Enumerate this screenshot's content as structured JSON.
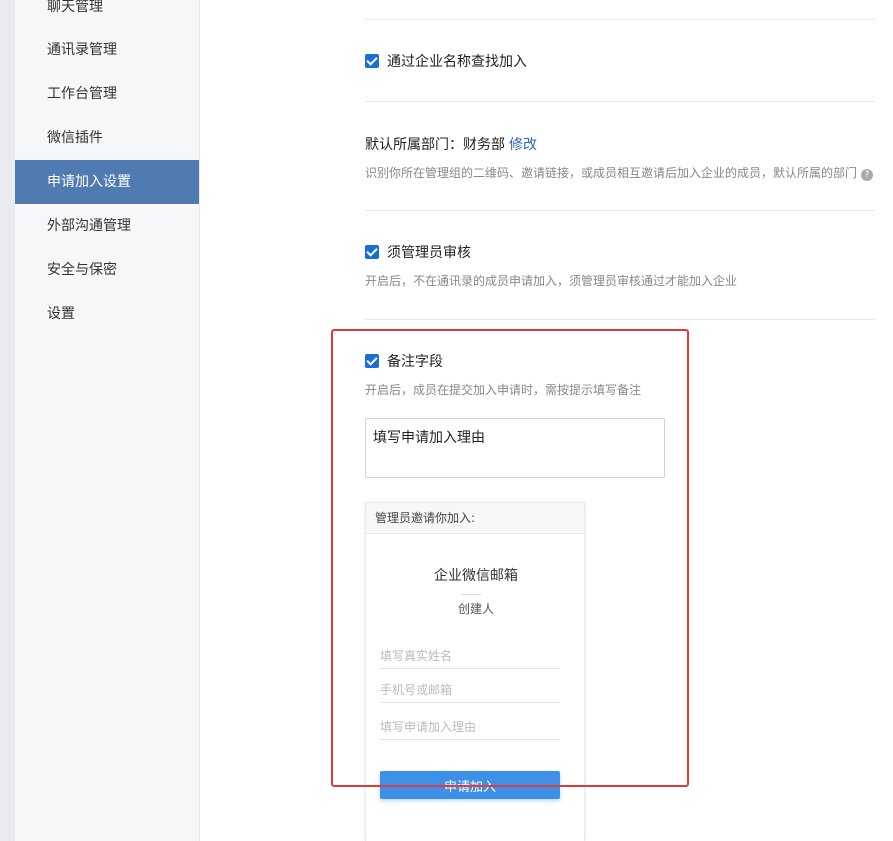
{
  "sidebar": {
    "items": [
      {
        "label": "聊天管理"
      },
      {
        "label": "通讯录管理"
      },
      {
        "label": "工作台管理"
      },
      {
        "label": "微信插件"
      },
      {
        "label": "申请加入设置"
      },
      {
        "label": "外部沟通管理"
      },
      {
        "label": "安全与保密"
      },
      {
        "label": "设置"
      }
    ],
    "active_index": 4
  },
  "settings": {
    "search_by_name": {
      "label": "通过企业名称查找加入",
      "checked": true
    },
    "default_dept": {
      "label": "默认所属部门：",
      "value": "财务部",
      "edit_link": "修改",
      "desc": "识别你所在管理组的二维码、邀请链接，或成员相互邀请后加入企业的成员，默认所属的部门",
      "help_icon": "?"
    },
    "admin_review": {
      "label": "须管理员审核",
      "checked": true,
      "desc": "开启后，不在通讯录的成员申请加入，须管理员审核通过才能加入企业"
    },
    "remark_field": {
      "label": "备注字段",
      "checked": true,
      "desc": "开启后，成员在提交加入申请时，需按提示填写备注",
      "input_value": "填写申请加入理由"
    }
  },
  "preview": {
    "header": "管理员邀请你加入:",
    "company": "企业微信邮箱",
    "creator": "创建人",
    "name_placeholder": "填写真实姓名",
    "contact_placeholder": "手机号或邮箱",
    "reason_placeholder": "填写申请加入理由",
    "submit_label": "申请加入"
  },
  "colors": {
    "accent": "#4f7bb2",
    "checkbox": "#1a6fd2",
    "button": "#3d8fe8",
    "highlight": "#e53935"
  }
}
